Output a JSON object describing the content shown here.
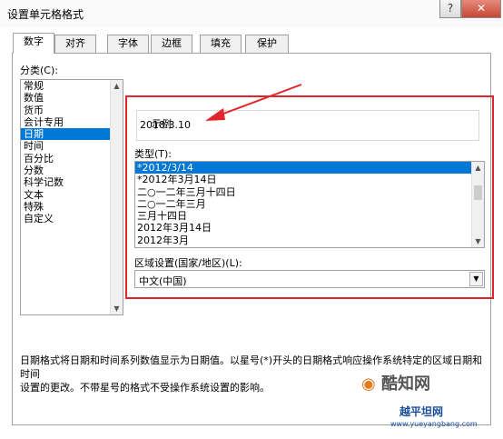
{
  "window": {
    "title": "设置单元格格式",
    "help": "?",
    "close": "✕"
  },
  "tabs": [
    "数字",
    "对齐",
    "字体",
    "边框",
    "填充",
    "保护"
  ],
  "category": {
    "label": "分类(C):",
    "items": [
      "常规",
      "数值",
      "货币",
      "会计专用",
      "日期",
      "时间",
      "百分比",
      "分数",
      "科学记数",
      "文本",
      "特殊",
      "自定义"
    ],
    "selected": "日期"
  },
  "sample": {
    "label": "示例",
    "value": "2018.3.10"
  },
  "type": {
    "label": "类型(T):",
    "items": [
      "*2012/3/14",
      "*2012年3月14日",
      "二○一二年三月十四日",
      "二○一二年三月",
      "三月十四日",
      "2012年3月14日",
      "2012年3月"
    ],
    "selected": "*2012/3/14"
  },
  "locale": {
    "label": "区域设置(国家/地区)(L):",
    "value": "中文(中国)"
  },
  "description": {
    "line1": "日期格式将日期和时间系列数值显示为日期值。以星号(*)开头的日期格式响应操作系统特定的区域日期和时间",
    "line2": "设置的更改。不带星号的格式不受操作系统设置的影响。"
  },
  "watermark": {
    "brand": "酷知网",
    "site_name": "越平坦网",
    "url": "www.yueyangbang.com"
  },
  "colors": {
    "highlight": "#e0262c",
    "selection": "#0078d7"
  }
}
